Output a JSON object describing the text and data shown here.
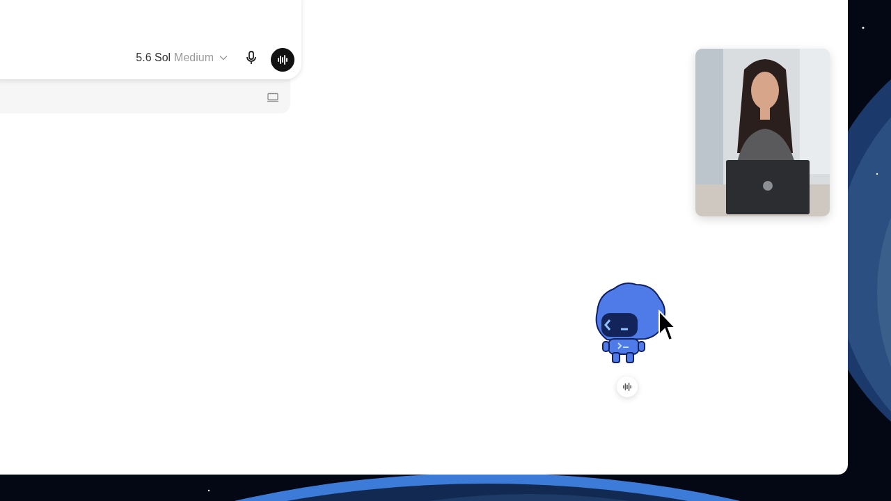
{
  "composer": {
    "model": "5.6 Sol",
    "effort": "Medium"
  }
}
